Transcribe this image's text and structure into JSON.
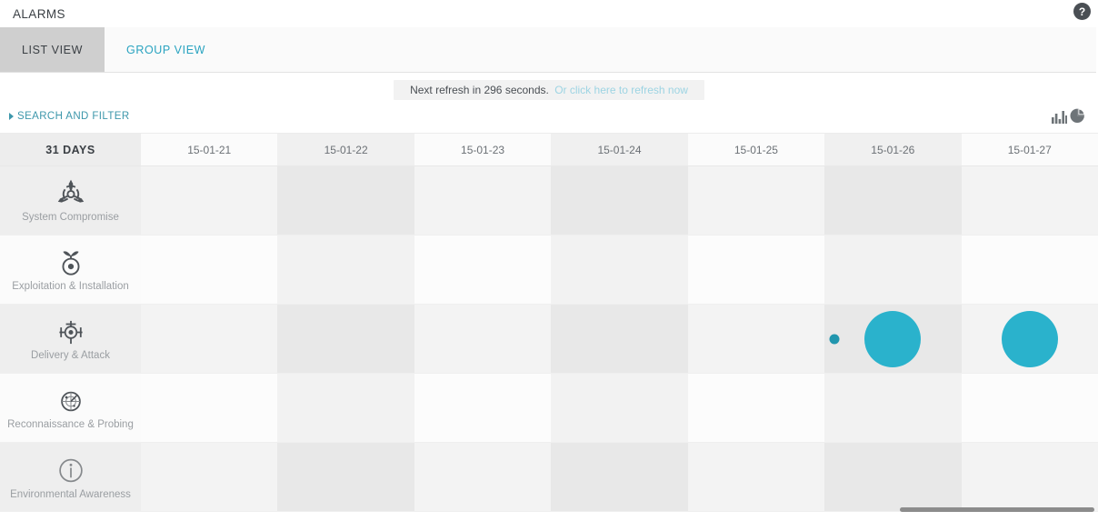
{
  "header": {
    "title": "ALARMS",
    "help_icon": "question-mark-icon",
    "help_label": "?"
  },
  "tabs": [
    {
      "label": "LIST VIEW",
      "active": true
    },
    {
      "label": "GROUP VIEW",
      "active": false
    }
  ],
  "refresh": {
    "text": "Next refresh in 296 seconds.",
    "link": "Or click here to refresh now",
    "seconds": 296
  },
  "filter": {
    "search_and_filter": "SEARCH AND FILTER",
    "caret_icon": "caret-right-icon",
    "bar_chart_icon": "bar-chart-icon",
    "pie_chart_icon": "pie-chart-icon"
  },
  "colors": {
    "accent_link": "#29a3c0",
    "bubble": "#2ab2cc",
    "bubble_small": "#2196ae",
    "active_tab_bg": "#cfcfcf",
    "refresh_link": "#9dd4e3"
  },
  "grid": {
    "corner_label": "31 DAYS",
    "columns": [
      "15-01-21",
      "15-01-22",
      "15-01-23",
      "15-01-24",
      "15-01-25",
      "15-01-26",
      "15-01-27"
    ],
    "rows": [
      {
        "label": "System Compromise",
        "icon": "biohazard-icon"
      },
      {
        "label": "Exploitation & Installation",
        "icon": "bomb-icon"
      },
      {
        "label": "Delivery & Attack",
        "icon": "crosshair-target-icon"
      },
      {
        "label": "Reconnaissance & Probing",
        "icon": "radar-icon"
      },
      {
        "label": "Environmental Awareness",
        "icon": "info-icon"
      }
    ],
    "bubbles": [
      {
        "row": 2,
        "column": 5,
        "size": 62,
        "cx": 0.5,
        "cy": 0.5,
        "variant": "large"
      },
      {
        "row": 2,
        "column": 5,
        "size": 11,
        "cx": 0.075,
        "cy": 0.5,
        "variant": "small"
      },
      {
        "row": 2,
        "column": 6,
        "size": 62,
        "cx": 0.5,
        "cy": 0.5,
        "variant": "large"
      }
    ]
  },
  "scrollbar": {
    "name": "horizontal-scrollbar"
  }
}
